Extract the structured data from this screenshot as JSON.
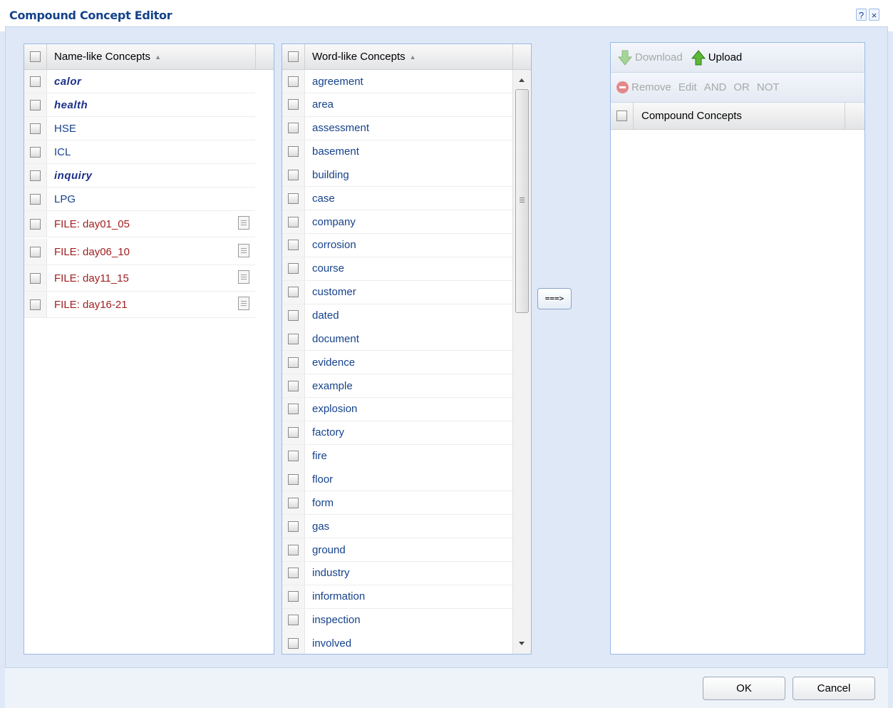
{
  "window": {
    "title": "Compound Concept Editor",
    "help_glyph": "?",
    "close_glyph": "×"
  },
  "name_grid": {
    "header": "Name-like Concepts",
    "sort_indicator": "▲",
    "rows": [
      {
        "label": "calor",
        "style": "italic"
      },
      {
        "label": "health",
        "style": "italic"
      },
      {
        "label": "HSE",
        "style": "plain"
      },
      {
        "label": "ICL",
        "style": "plain"
      },
      {
        "label": "inquiry",
        "style": "italic"
      },
      {
        "label": "LPG",
        "style": "plain"
      },
      {
        "label": "FILE: day01_05",
        "style": "file",
        "icon": "document-icon"
      },
      {
        "label": "FILE: day06_10",
        "style": "file",
        "icon": "document-icon"
      },
      {
        "label": "FILE: day11_15",
        "style": "file",
        "icon": "document-icon"
      },
      {
        "label": "FILE: day16-21",
        "style": "file",
        "icon": "document-icon"
      }
    ]
  },
  "word_grid": {
    "header": "Word-like Concepts",
    "sort_indicator": "▲",
    "rows": [
      "agreement",
      "area",
      "assessment",
      "basement",
      "building",
      "case",
      "company",
      "corrosion",
      "course",
      "customer",
      "dated",
      "document",
      "evidence",
      "example",
      "explosion",
      "factory",
      "fire",
      "floor",
      "form",
      "gas",
      "ground",
      "industry",
      "information",
      "inspection",
      "involved"
    ]
  },
  "transfer_button": {
    "label": "===>"
  },
  "compound_panel": {
    "toolbar1": {
      "download_label": "Download",
      "upload_label": "Upload"
    },
    "toolbar2": {
      "remove_label": "Remove",
      "edit_label": "Edit",
      "and_label": "AND",
      "or_label": "OR",
      "not_label": "NOT"
    },
    "header": "Compound Concepts",
    "rows": []
  },
  "footer": {
    "ok_label": "OK",
    "cancel_label": "Cancel"
  },
  "colors": {
    "link_text": "#15428b",
    "file_text": "#a02020",
    "arrow_green": "#4caf50",
    "panel_border": "#99bbe8"
  }
}
